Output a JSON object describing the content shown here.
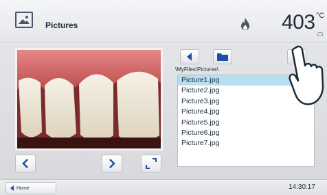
{
  "header": {
    "title": "Pictures",
    "temperature": "403",
    "temperature_unit": "°C",
    "app_icon": "picture-icon",
    "status_icon": "flame-icon"
  },
  "explorer": {
    "path": "\\MyFiles\\Pictures\\",
    "files": [
      "Picture1.jpg",
      "Picture2.jpg",
      "Picture3.jpg",
      "Picture4.jpg",
      "Picture5.jpg",
      "Picture6.jpg",
      "Picture7.jpg"
    ],
    "selected_index": 0
  },
  "viewer": {
    "prev_icon": "chevron-left-icon",
    "next_icon": "chevron-right-icon",
    "fullscreen_icon": "fullscreen-icon"
  },
  "footer": {
    "home_label": "Home",
    "time": "14:30:17"
  },
  "colors": {
    "accent": "#1e4fa0",
    "selection": "#b8dff0",
    "background": "#dcdde0"
  }
}
